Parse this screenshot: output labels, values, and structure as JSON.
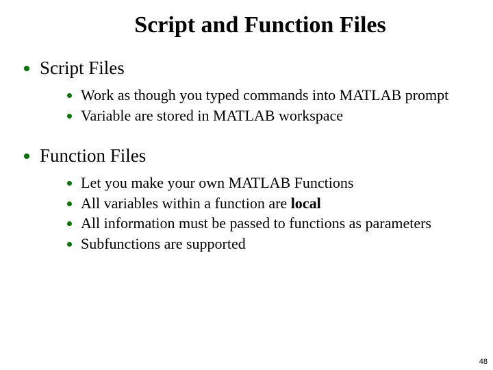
{
  "title": "Script and Function Files",
  "sections": [
    {
      "heading": "Script Files",
      "items": [
        {
          "pre": "Work as though you typed commands into MATLAB prompt"
        },
        {
          "pre": "Variable are stored in MATLAB workspace"
        }
      ]
    },
    {
      "heading": "Function Files",
      "items": [
        {
          "pre": "Let you make your own MATLAB Functions"
        },
        {
          "pre": "All variables within a function are ",
          "bold": "local"
        },
        {
          "pre": "All information must be passed to functions as parameters"
        },
        {
          "pre": "Subfunctions are supported"
        }
      ]
    }
  ],
  "page_number": "48"
}
